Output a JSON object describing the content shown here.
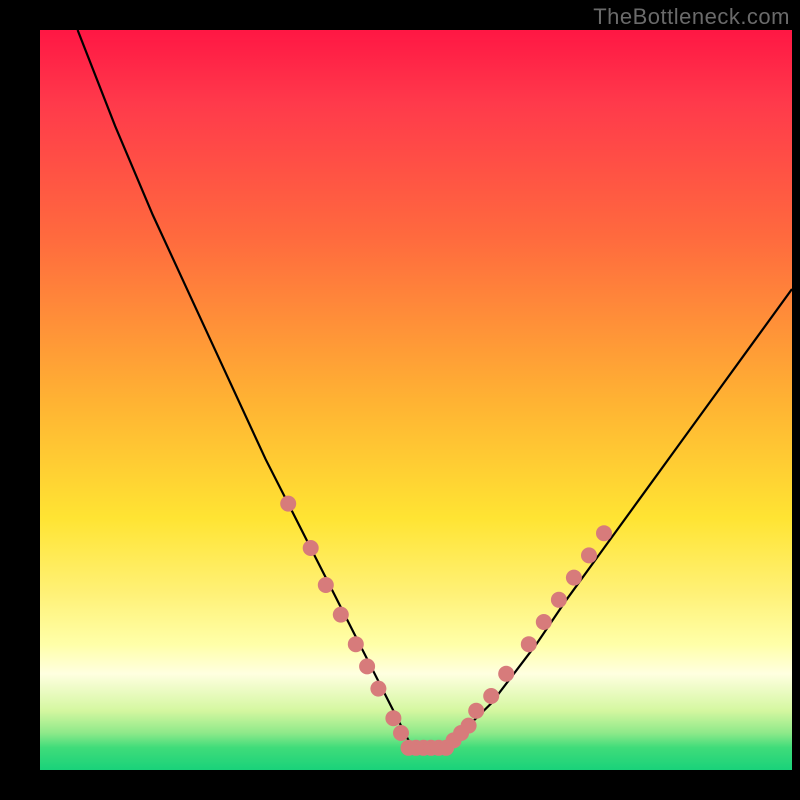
{
  "watermark": "TheBottleneck.com",
  "chart_data": {
    "type": "line",
    "title": "",
    "xlabel": "",
    "ylabel": "",
    "xlim": [
      0,
      100
    ],
    "ylim": [
      0,
      100
    ],
    "grid": false,
    "legend": false,
    "background_gradient_stops": [
      {
        "pos": 0,
        "color": "#ff1744"
      },
      {
        "pos": 28,
        "color": "#ff6a3e"
      },
      {
        "pos": 50,
        "color": "#ffb233"
      },
      {
        "pos": 70,
        "color": "#ffe433"
      },
      {
        "pos": 85,
        "color": "#ffffc8"
      },
      {
        "pos": 100,
        "color": "#19d27a"
      }
    ],
    "series": [
      {
        "name": "bottleneck-curve",
        "stroke": "#000000",
        "x": [
          5,
          10,
          15,
          20,
          25,
          30,
          33,
          36,
          39,
          42,
          44,
          46,
          47,
          48,
          49,
          50,
          51,
          52,
          53,
          55,
          57,
          60,
          63,
          66,
          70,
          75,
          80,
          85,
          90,
          95,
          100
        ],
        "y": [
          100,
          87,
          75,
          64,
          53,
          42,
          36,
          30,
          24,
          18,
          14,
          10,
          8,
          6,
          4,
          3,
          3,
          3,
          3,
          4,
          6,
          9,
          13,
          17,
          23,
          30,
          37,
          44,
          51,
          58,
          65
        ]
      }
    ],
    "markers": {
      "name": "highlighted-points",
      "color": "#d77b7b",
      "radius_px": 8,
      "points": [
        {
          "x": 33,
          "y": 36
        },
        {
          "x": 36,
          "y": 30
        },
        {
          "x": 38,
          "y": 25
        },
        {
          "x": 40,
          "y": 21
        },
        {
          "x": 42,
          "y": 17
        },
        {
          "x": 43.5,
          "y": 14
        },
        {
          "x": 45,
          "y": 11
        },
        {
          "x": 47,
          "y": 7
        },
        {
          "x": 48,
          "y": 5
        },
        {
          "x": 49,
          "y": 3
        },
        {
          "x": 50,
          "y": 3
        },
        {
          "x": 51,
          "y": 3
        },
        {
          "x": 52,
          "y": 3
        },
        {
          "x": 53,
          "y": 3
        },
        {
          "x": 54,
          "y": 3
        },
        {
          "x": 55,
          "y": 4
        },
        {
          "x": 56,
          "y": 5
        },
        {
          "x": 57,
          "y": 6
        },
        {
          "x": 58,
          "y": 8
        },
        {
          "x": 60,
          "y": 10
        },
        {
          "x": 62,
          "y": 13
        },
        {
          "x": 65,
          "y": 17
        },
        {
          "x": 67,
          "y": 20
        },
        {
          "x": 69,
          "y": 23
        },
        {
          "x": 71,
          "y": 26
        },
        {
          "x": 73,
          "y": 29
        },
        {
          "x": 75,
          "y": 32
        }
      ]
    }
  }
}
